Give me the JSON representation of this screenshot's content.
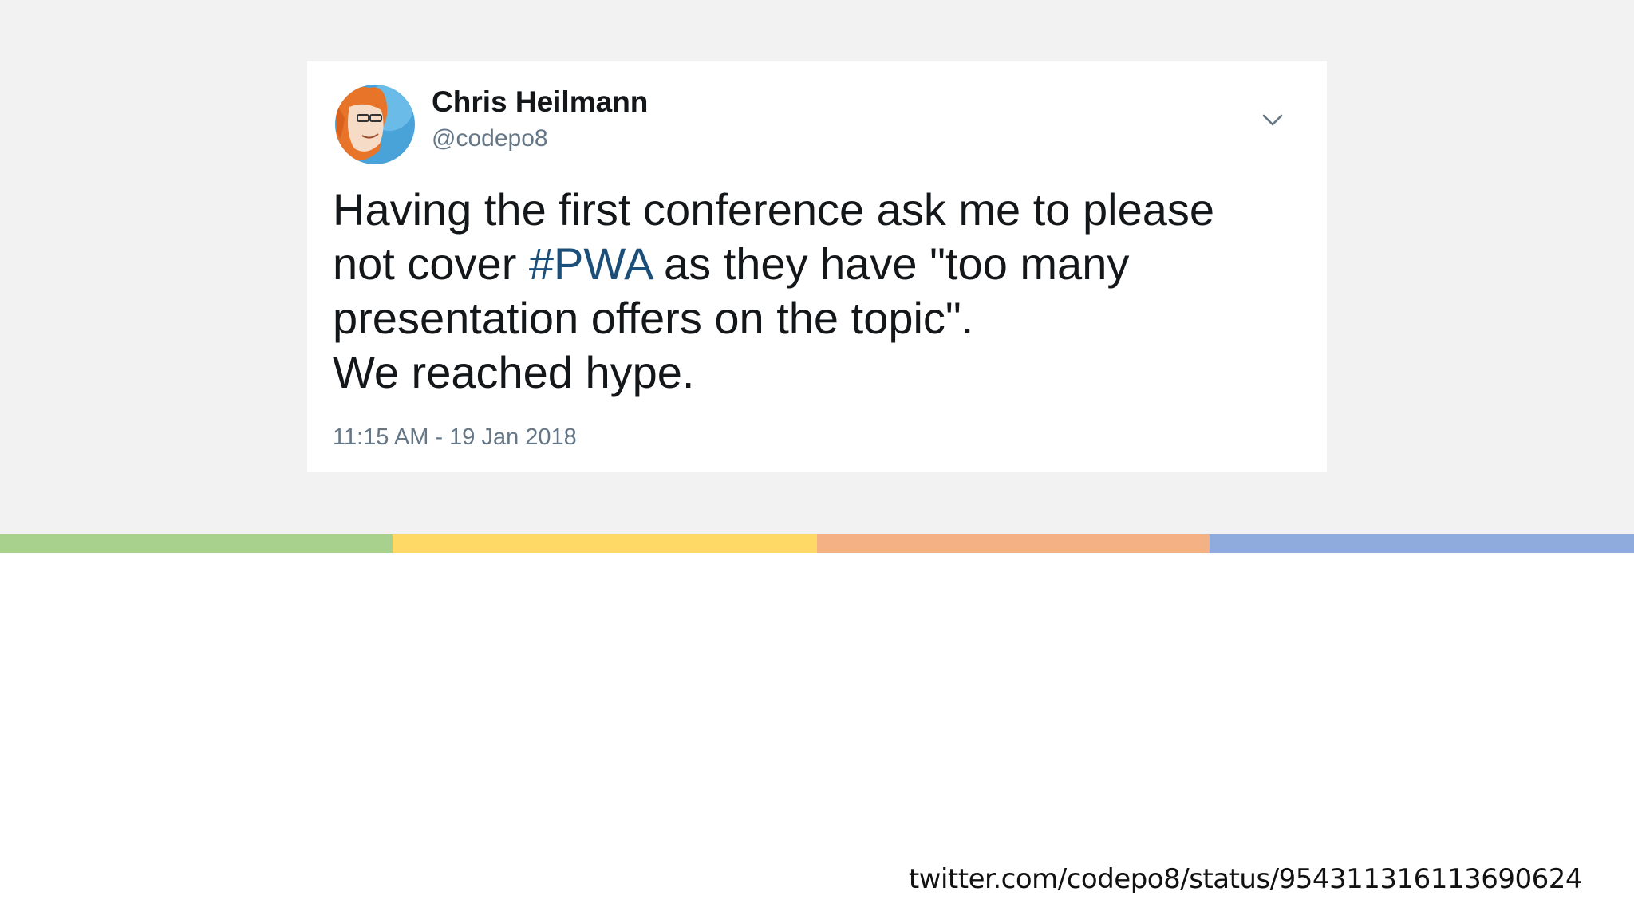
{
  "colors": {
    "background_top": "#f3f2f3",
    "stripe": [
      "#a9d18e",
      "#ffd966",
      "#f4b183",
      "#8faadc"
    ],
    "hashtag": "#1b4f7a",
    "handle": "#657786"
  },
  "tweet": {
    "author_name": "Chris Heilmann",
    "author_handle": "@codepo8",
    "avatar_icon": "avatar-illustration",
    "menu_icon": "chevron-down-icon",
    "text_line1": "Having the first conference ask me to please",
    "text_line2_prefix": "not cover ",
    "hashtag": "#PWA",
    "text_line2_suffix": " as they have \"too many",
    "text_line3": "presentation offers on the topic\".",
    "text_line4": "We reached hype.",
    "timestamp": "11:15 AM - 19 Jan 2018"
  },
  "footer": {
    "source_url": "twitter.com/codepo8/status/954311316113690624"
  }
}
